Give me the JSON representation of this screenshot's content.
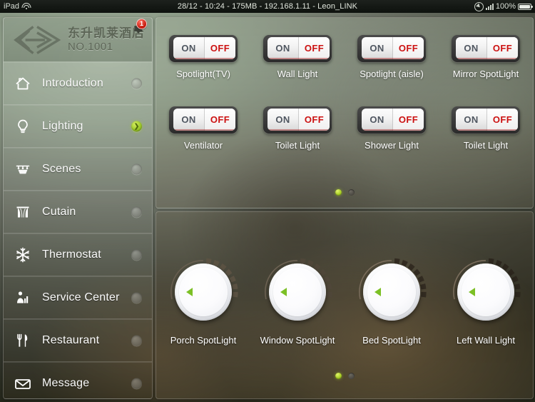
{
  "statusbar": {
    "device": "iPad",
    "wifi_icon": "wifi-icon",
    "center": "28/12 - 10:24 - 175MB - 192.168.1.11 - Leon_LINK",
    "location_icon": "location-icon",
    "signal_icon": "signal-bars-icon",
    "battery_percent": "100%",
    "battery_icon": "battery-icon"
  },
  "sidebar": {
    "brand": {
      "logo_icon": "hotel-logo-icon",
      "name_cn": "东升凯莱酒店",
      "room_no": "NO.1001",
      "settings_icon": "gear-icon",
      "badge_count": "1"
    },
    "items": [
      {
        "label": "Introduction",
        "icon": "house-icon",
        "active": false
      },
      {
        "label": "Lighting",
        "icon": "lightbulb-icon",
        "active": true
      },
      {
        "label": "Scenes",
        "icon": "chandelier-icon",
        "active": false
      },
      {
        "label": "Cutain",
        "icon": "curtain-icon",
        "active": false
      },
      {
        "label": "Thermostat",
        "icon": "snowflake-icon",
        "active": false
      },
      {
        "label": "Service Center",
        "icon": "service-bell-icon",
        "active": false
      },
      {
        "label": "Restaurant",
        "icon": "fork-knife-icon",
        "active": false
      },
      {
        "label": "Message",
        "icon": "envelope-icon",
        "active": false
      }
    ]
  },
  "switch_panel": {
    "on_label": "ON",
    "off_label": "OFF",
    "devices": [
      {
        "label": "Spotlight(TV)",
        "state": "OFF"
      },
      {
        "label": "Wall Light",
        "state": "OFF"
      },
      {
        "label": "Spotlight (aisle)",
        "state": "OFF"
      },
      {
        "label": "Mirror SpotLight",
        "state": "OFF"
      },
      {
        "label": "Ventilator",
        "state": "OFF"
      },
      {
        "label": "Toilet Light",
        "state": "OFF"
      },
      {
        "label": "Shower Light",
        "state": "OFF"
      },
      {
        "label": "Toilet Light",
        "state": "OFF"
      }
    ],
    "pages": {
      "count": 2,
      "current": 1
    }
  },
  "dimmer_panel": {
    "dimmers": [
      {
        "label": "Porch SpotLight",
        "value": 0
      },
      {
        "label": "Window SpotLight",
        "value": 0
      },
      {
        "label": "Bed SpotLight",
        "value": 0
      },
      {
        "label": "Left Wall Light",
        "value": 0
      }
    ],
    "pages": {
      "count": 2,
      "current": 1
    }
  },
  "colors": {
    "accent_green": "#9fc82a",
    "off_red": "#cc1111",
    "badge_red": "#c01408",
    "pointer_green": "#7cc026"
  }
}
